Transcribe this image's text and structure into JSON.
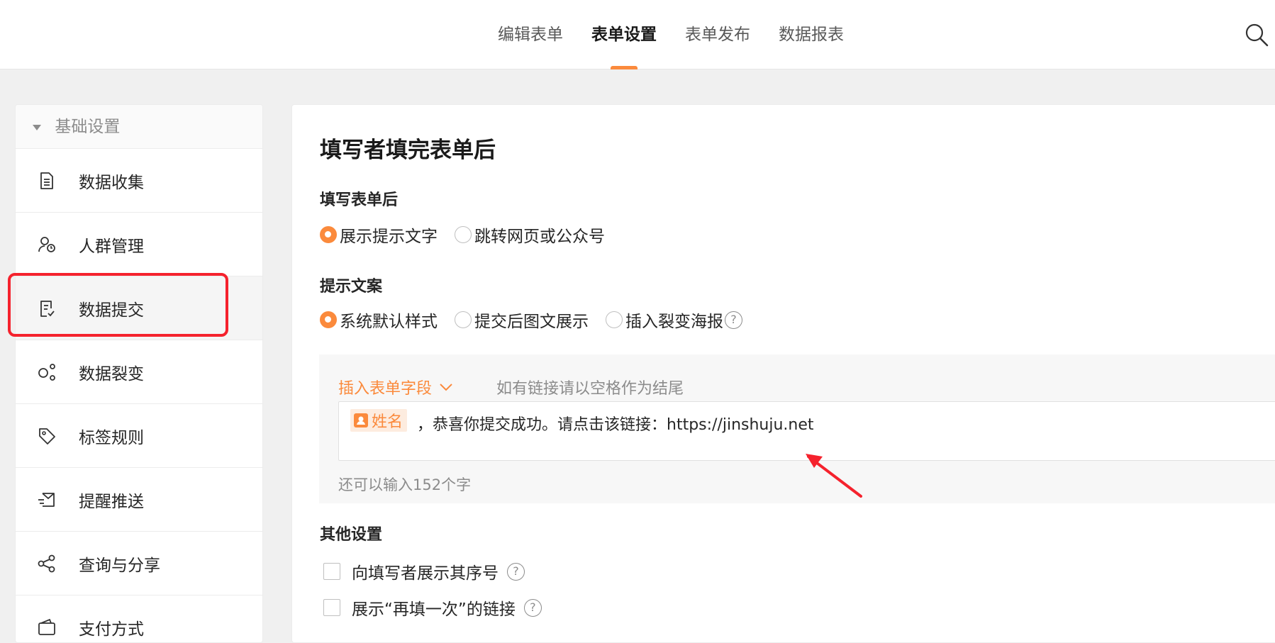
{
  "nav": {
    "tabs": [
      {
        "label": "编辑表单"
      },
      {
        "label": "表单设置"
      },
      {
        "label": "表单发布"
      },
      {
        "label": "数据报表"
      }
    ],
    "active_tab": "表单设置",
    "accent_color": "#fb8a3c"
  },
  "sidebar": {
    "group_label": "基础设置",
    "items": [
      {
        "label": "数据收集",
        "icon": "document-icon"
      },
      {
        "label": "人群管理",
        "icon": "user-settings-icon"
      },
      {
        "label": "数据提交",
        "icon": "document-check-icon"
      },
      {
        "label": "数据裂变",
        "icon": "share-nodes-icon"
      },
      {
        "label": "标签规则",
        "icon": "tag-icon"
      },
      {
        "label": "提醒推送",
        "icon": "send-icon"
      },
      {
        "label": "查询与分享",
        "icon": "share-icon"
      },
      {
        "label": "支付方式",
        "icon": "wallet-icon"
      }
    ],
    "active_item": "数据提交",
    "highlight_color": "#f5222d"
  },
  "main": {
    "title": "填写者填完表单后",
    "after_submit": {
      "label": "填写表单后",
      "options": [
        "展示提示文字",
        "跳转网页或公众号"
      ],
      "selected": "展示提示文字"
    },
    "prompt_copy": {
      "label": "提示文案",
      "options": [
        "系统默认样式",
        "提交后图文展示",
        "插入裂变海报"
      ],
      "selected": "系统默认样式"
    },
    "editor": {
      "insert_field_label": "插入表单字段",
      "hint": "如有链接请以空格作为结尾",
      "chip_label": "姓名",
      "content": "，恭喜你提交成功。请点击该链接：https://jinshuju.net",
      "remaining": "还可以输入152个字"
    },
    "other_settings": {
      "label": "其他设置",
      "checkboxes": [
        {
          "label": "向填写者展示其序号",
          "checked": false
        },
        {
          "label": "展示“再填一次”的链接",
          "checked": false
        }
      ]
    }
  }
}
